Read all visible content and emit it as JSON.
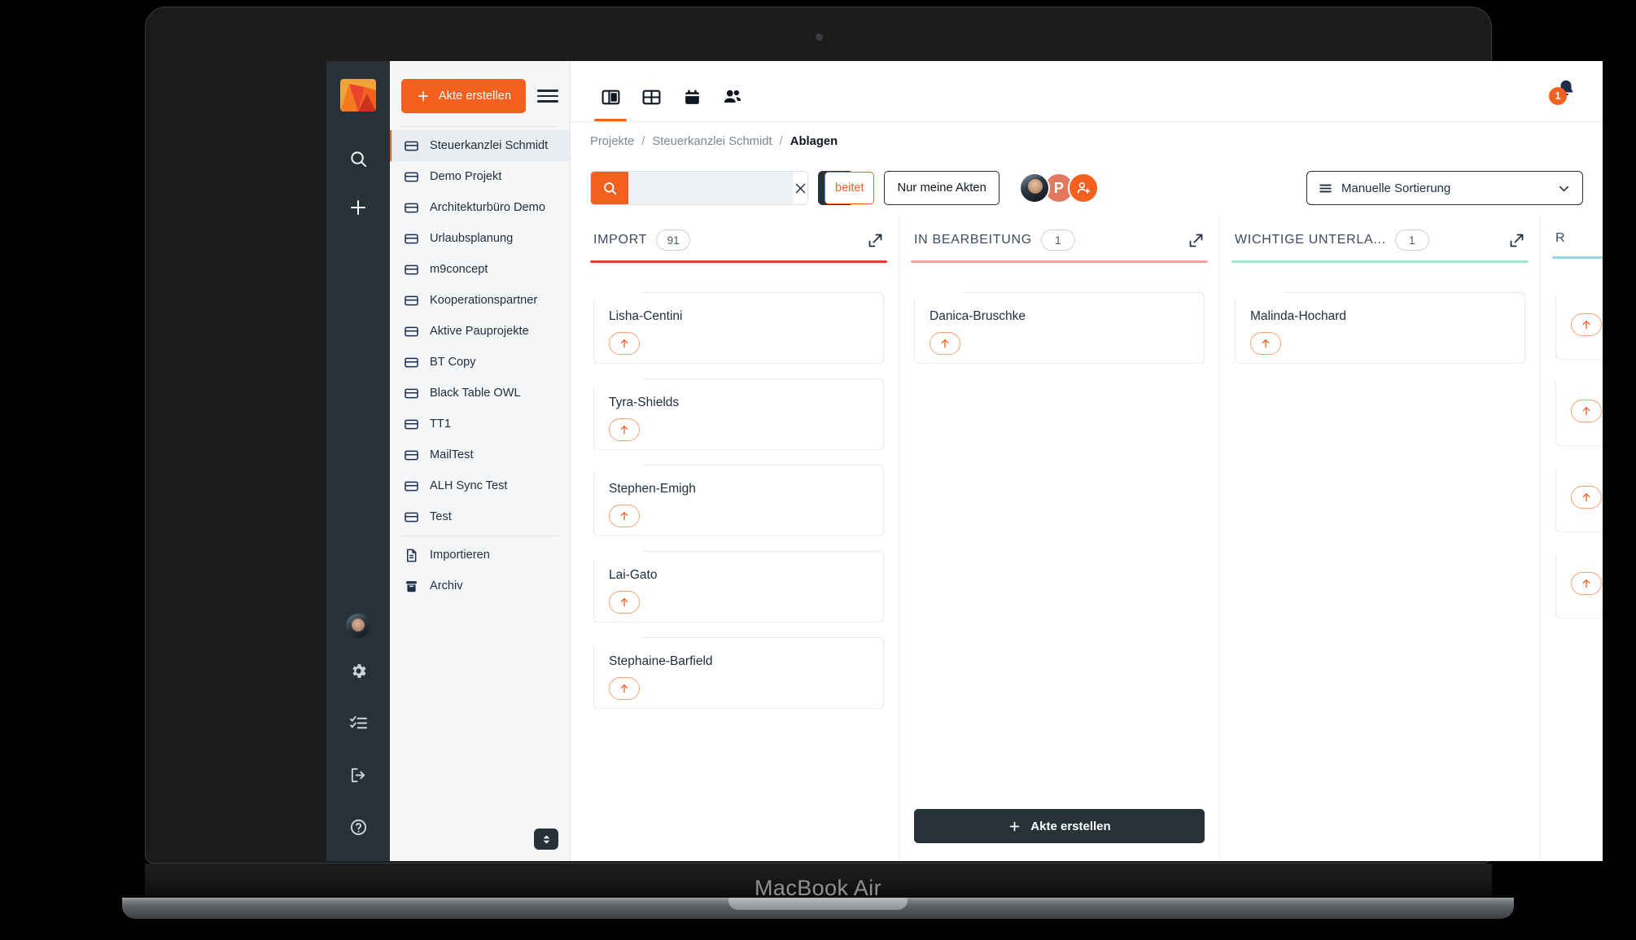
{
  "device": {
    "label": "MacBook Air"
  },
  "rail": {
    "logo_name": "app-logo",
    "icons": [
      {
        "name": "search-icon"
      },
      {
        "name": "plus-icon"
      }
    ],
    "bottom_icons": [
      {
        "name": "user-avatar"
      },
      {
        "name": "gear-icon"
      },
      {
        "name": "tasks-list-icon"
      },
      {
        "name": "logout-icon"
      },
      {
        "name": "help-circle-icon"
      }
    ]
  },
  "sidebar": {
    "create_button": "Akte erstellen",
    "menu_icon": "hamburger-icon",
    "resize_icon": "expand-vertical-icon",
    "items": [
      {
        "label": "Steuerkanzlei Schmidt",
        "icon": "card-icon",
        "active": true
      },
      {
        "label": "Demo Projekt",
        "icon": "card-icon",
        "active": false
      },
      {
        "label": "Architekturbüro Demo",
        "icon": "card-icon",
        "active": false
      },
      {
        "label": "Urlaubsplanung",
        "icon": "card-icon",
        "active": false
      },
      {
        "label": "m9concept",
        "icon": "card-icon",
        "active": false
      },
      {
        "label": "Kooperationspartner",
        "icon": "card-icon",
        "active": false
      },
      {
        "label": "Aktive Pauprojekte",
        "icon": "card-icon",
        "active": false
      },
      {
        "label": "BT Copy",
        "icon": "card-icon",
        "active": false
      },
      {
        "label": "Black Table OWL",
        "icon": "card-icon",
        "active": false
      },
      {
        "label": "TT1",
        "icon": "card-icon",
        "active": false
      },
      {
        "label": "MailTest",
        "icon": "card-icon",
        "active": false
      },
      {
        "label": "ALH Sync Test",
        "icon": "card-icon",
        "active": false
      },
      {
        "label": "Test",
        "icon": "card-icon",
        "active": false
      }
    ],
    "footer_items": [
      {
        "label": "Importieren",
        "icon": "document-icon"
      },
      {
        "label": "Archiv",
        "icon": "archive-box-icon"
      }
    ]
  },
  "topbar": {
    "tabs": [
      {
        "name": "board-view-icon",
        "active": true
      },
      {
        "name": "table-view-icon",
        "active": false
      },
      {
        "name": "calendar-view-icon",
        "active": false
      },
      {
        "name": "contacts-view-icon",
        "active": false
      }
    ],
    "notification_icon": "bell-icon",
    "notification_count": "1"
  },
  "breadcrumb": {
    "items": [
      {
        "label": "Projekte",
        "current": false
      },
      {
        "label": "Steuerkanzlei Schmidt",
        "current": false
      },
      {
        "label": "Ablagen",
        "current": true
      }
    ],
    "separator": "/"
  },
  "filterbar": {
    "search": {
      "value": "",
      "placeholder": "",
      "icon": "search-icon",
      "clear_icon": "close-icon"
    },
    "layout_toggle_icon": "split-layout-icon",
    "chip_edited": "beitet",
    "chip_mine": "Nur meine Akten",
    "avatars": [
      {
        "name": "member-avatar-photo",
        "initial": "",
        "color": "#2d3a45"
      },
      {
        "name": "member-avatar-p",
        "initial": "P",
        "color": "#e0795e"
      },
      {
        "name": "add-member-avatar",
        "initial": "",
        "color": "#f4601f"
      }
    ],
    "sort": {
      "label": "Manuelle Sortierung",
      "icon": "sort-lines-icon",
      "chevron": "chevron-down-icon"
    }
  },
  "board": {
    "create_button": "Akte erstellen",
    "expand_icon": "expand-column-icon",
    "card_action_icon": "arrow-up-icon",
    "columns": [
      {
        "title": "IMPORT",
        "count": "91",
        "accent": "#f03b34",
        "show_create": false,
        "cards": [
          {
            "title": "Lisha-Centini"
          },
          {
            "title": "Tyra-Shields"
          },
          {
            "title": "Stephen-Emigh"
          },
          {
            "title": "Lai-Gato"
          },
          {
            "title": "Stephaine-Barfield"
          }
        ]
      },
      {
        "title": "IN BEARBEITUNG",
        "count": "1",
        "accent": "#f0a79e",
        "show_create": true,
        "cards": [
          {
            "title": "Danica-Bruschke"
          }
        ]
      },
      {
        "title": "WICHTIGE UNTERLA...",
        "count": "1",
        "accent": "#9fe8cd",
        "show_create": false,
        "cards": [
          {
            "title": "Malinda-Hochard"
          }
        ]
      },
      {
        "title": "R",
        "count": "",
        "accent": "#8fd8ea",
        "show_create": false,
        "cards": [
          {
            "title": ""
          },
          {
            "title": ""
          },
          {
            "title": ""
          },
          {
            "title": ""
          }
        ]
      }
    ]
  }
}
